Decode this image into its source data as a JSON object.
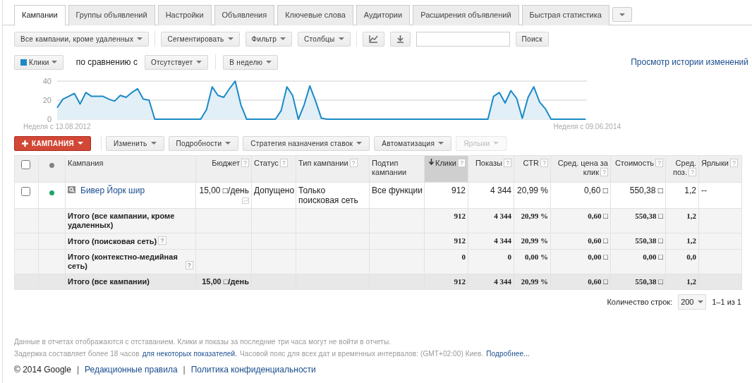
{
  "tabs": [
    {
      "label": "Кампании",
      "selected": true
    },
    {
      "label": "Группы объявлений",
      "selected": false
    },
    {
      "label": "Настройки",
      "selected": false
    },
    {
      "label": "Объявления",
      "selected": false
    },
    {
      "label": "Ключевые слова",
      "selected": false
    },
    {
      "label": "Аудитории",
      "selected": false
    },
    {
      "label": "Расширения объявлений",
      "selected": false
    },
    {
      "label": "Быстрая статистика",
      "selected": false
    }
  ],
  "toolbar": {
    "dropdowns": [
      "Все кампании, кроме удаленных",
      "Сегментировать",
      "Фильтр",
      "Столбцы"
    ],
    "search_button": "Поиск"
  },
  "chart_controls": {
    "metric": {
      "label": "Клики",
      "color": "#1a8ac6"
    },
    "compare_label": "по сравнению с",
    "compare": "Отсутствует",
    "period": "В неделю",
    "history_link": "Просмотр истории изменений"
  },
  "chart": {
    "chart_data": {
      "type": "area",
      "categories": [
        "Неделя с 13.08.2012",
        null,
        null,
        null,
        null,
        null,
        null,
        null,
        null,
        null,
        null,
        null,
        null,
        null,
        null,
        null,
        null,
        null,
        null,
        null,
        null,
        null,
        null,
        null,
        null,
        null,
        null,
        null,
        null,
        null,
        null,
        null,
        null,
        null,
        null,
        null,
        null,
        null,
        null,
        null,
        null,
        null,
        null,
        null,
        null,
        null,
        null,
        null,
        null,
        null,
        null,
        null,
        null,
        null,
        null,
        null,
        null,
        null,
        null,
        null,
        null,
        null,
        null,
        null,
        null,
        null,
        null,
        null,
        null,
        null,
        null,
        null,
        null,
        null,
        null,
        null,
        null,
        null,
        null,
        null,
        null,
        null,
        null,
        null,
        null,
        null,
        null,
        null,
        null,
        null,
        null,
        null,
        "Неделя с 09.06.2014"
      ],
      "yticks": [
        0,
        20,
        40
      ],
      "ylim": [
        0,
        40
      ],
      "series": [
        {
          "color": "#1a8ac6",
          "values": [
            12,
            21,
            24,
            27,
            16,
            28,
            24,
            24,
            24,
            21,
            19,
            25,
            23,
            28,
            32,
            21,
            20,
            0,
            0,
            0,
            0,
            0,
            0,
            0,
            0,
            0,
            10,
            34,
            25,
            23,
            32,
            40,
            15,
            0,
            0,
            0,
            0,
            0,
            0,
            9,
            34,
            25,
            0,
            15,
            35,
            19,
            1,
            0,
            0,
            0,
            0,
            0,
            0,
            0,
            0,
            0,
            0,
            0,
            0,
            0,
            0,
            0,
            0,
            0,
            0,
            0,
            0,
            0,
            0,
            0,
            0,
            0,
            0,
            0,
            0,
            0,
            24,
            28,
            17,
            30,
            22,
            1,
            23,
            34,
            18,
            11,
            0,
            0,
            0,
            0,
            0,
            0,
            0
          ]
        }
      ]
    }
  },
  "actions": [
    {
      "label": "КАМПАНИЯ",
      "kind": "primary",
      "disabled": false
    },
    {
      "label": "Изменить",
      "kind": "dropdown",
      "disabled": false
    },
    {
      "label": "Подробности",
      "kind": "dropdown",
      "disabled": false
    },
    {
      "label": "Стратегия назначения ставок",
      "kind": "dropdown",
      "disabled": false
    },
    {
      "label": "Автоматизация",
      "kind": "dropdown",
      "disabled": false
    },
    {
      "label": "Ярлыки",
      "kind": "dropdown",
      "disabled": true
    }
  ],
  "table": {
    "columns": [
      {
        "kind": "checkbox",
        "checked": false,
        "sorted": false
      },
      {
        "kind": "status",
        "color": "#808080",
        "sorted": false
      },
      {
        "kind": "text",
        "label": "Кампания",
        "sorted": false
      },
      {
        "kind": "text",
        "label": "Бюджет",
        "help": "?",
        "sorted": false
      },
      {
        "kind": "text",
        "label": "Статус",
        "help": "?",
        "sorted": false
      },
      {
        "kind": "text",
        "label": "Тип кампании",
        "help": "?",
        "sorted": false
      },
      {
        "kind": "text",
        "label": "Подтип кампании",
        "sorted": false
      },
      {
        "kind": "text",
        "label": "Клики",
        "help": "?",
        "sorted": true
      },
      {
        "kind": "text",
        "label": "Показы",
        "help": "?",
        "sorted": false
      },
      {
        "kind": "text",
        "label": "CTR",
        "help": "?",
        "sorted": false
      },
      {
        "kind": "text",
        "label": "Сред. цена за клик",
        "help": "?",
        "sorted": false
      },
      {
        "kind": "text",
        "label": "Стоимость",
        "help": "?",
        "sorted": false
      },
      {
        "kind": "text",
        "label": "Сред. поз.",
        "help": "?",
        "sorted": false
      },
      {
        "kind": "text",
        "label": "Ярлыки",
        "help": "?",
        "sorted": false
      }
    ],
    "rows": [
      {
        "kind": "campaign",
        "checked": false,
        "color": "#1da462",
        "cells": [
          "",
          "",
          "Бивер Йорк шир",
          "15,00 □/день",
          "Допущено",
          "Только поисковая сеть",
          "Все функции",
          "912",
          "4 344",
          "20,99 %",
          "0,60 □",
          "550,38 □",
          "1,2",
          "--"
        ]
      },
      {
        "kind": "total",
        "cells": [
          "",
          "",
          "Итого (все кампании, кроме удаленных)",
          "",
          "",
          "",
          "",
          "912",
          "4 344",
          "20,99 %",
          "0,60 □",
          "550,38 □",
          "1,2",
          ""
        ]
      },
      {
        "kind": "total",
        "help": "?",
        "cells": [
          "",
          "",
          "Итого (поисковая сеть)",
          "",
          "",
          "",
          "",
          "912",
          "4 344",
          "20,99 %",
          "0,60 □",
          "550,38 □",
          "1,2",
          ""
        ]
      },
      {
        "kind": "total",
        "help": "?",
        "cells": [
          "",
          "",
          "Итого (контекстно-медийная сеть)",
          "",
          "",
          "",
          "",
          "0",
          "0",
          "0,00 %",
          "0,00 □",
          "0,00 □",
          "0,0",
          ""
        ]
      },
      {
        "kind": "grand_total",
        "cells": [
          "",
          "",
          "Итого (все кампании)",
          "15,00 □/день",
          "",
          "",
          "",
          "912",
          "4 344",
          "20,99 %",
          "0,60 □",
          "550,38 □",
          "1,2",
          ""
        ]
      }
    ]
  },
  "pagination": {
    "label": "Количество строк:",
    "value": "200",
    "range": "1–1 из 1"
  },
  "footer": {
    "notes": [
      [
        {
          "text": "Данные в отчетах отображаются с отставанием. Клики и показы за последние три часа могут не войти в отчеты.",
          "link": false
        }
      ],
      [
        {
          "text": "Задержка составляет более 18 часов",
          "link": false
        },
        {
          "text": "для некоторых показателей.",
          "link": true
        },
        {
          "text": "Часовой пояс для всех дат и временных интервалов: (GMT+02:00) Киев.",
          "link": false
        },
        {
          "text": "Подробнее...",
          "link": true
        }
      ]
    ],
    "bottom": [
      {
        "text": "© 2014 Google",
        "kind": "text"
      },
      {
        "text": "|",
        "kind": "separator"
      },
      {
        "text": "Редакционные правила",
        "kind": "link"
      },
      {
        "text": "|",
        "kind": "separator"
      },
      {
        "text": "Политика конфиденциальности",
        "kind": "link"
      }
    ]
  }
}
